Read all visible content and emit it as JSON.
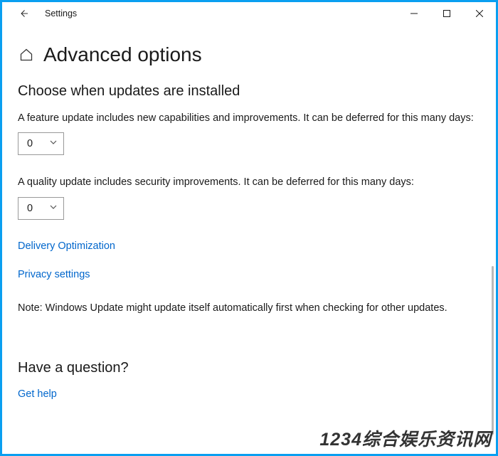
{
  "titlebar": {
    "title": "Settings"
  },
  "page": {
    "title": "Advanced options"
  },
  "section": {
    "heading": "Choose when updates are installed",
    "feature_desc": "A feature update includes new capabilities and improvements. It can be deferred for this many days:",
    "feature_value": "0",
    "quality_desc": "A quality update includes security improvements. It can be deferred for this many days:",
    "quality_value": "0"
  },
  "links": {
    "delivery": "Delivery Optimization",
    "privacy": "Privacy settings",
    "get_help": "Get help"
  },
  "note": "Note: Windows Update might update itself automatically first when checking for other updates.",
  "question_heading": "Have a question?",
  "watermark": "1234综合娱乐资讯网"
}
